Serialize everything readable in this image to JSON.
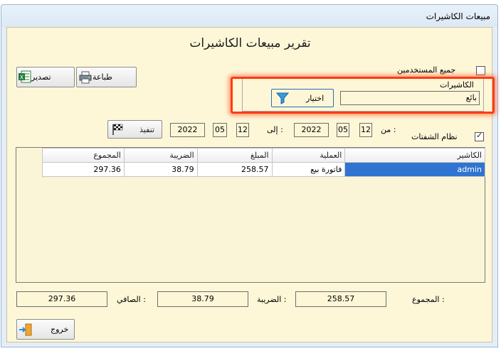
{
  "window": {
    "title": "مبيعات الكاشيرات"
  },
  "report": {
    "title": "تقرير مبيعات الكاشيرات"
  },
  "toolbar": {
    "print_label": "طباعة",
    "export_label": "تصدير",
    "execute_label": "تنفيذ",
    "exit_label": "خروج"
  },
  "filters": {
    "all_users_label": "جميع المستخدمين",
    "all_users_checked": false,
    "cashiers_group_label": "الكاشيرات",
    "cashier_value": "بائع",
    "choose_label": "اختيار",
    "shifts_label": "نظام الشفتات",
    "shifts_checked": true,
    "from_label": "من :",
    "to_label": "إلى :",
    "from": {
      "day": "12",
      "month": "05",
      "year": "2022"
    },
    "to": {
      "day": "12",
      "month": "05",
      "year": "2022"
    }
  },
  "table": {
    "columns": [
      "الكاشير",
      "العملية",
      "المبلغ",
      "الضريبة",
      "المجموع"
    ],
    "rows": [
      {
        "cashier": "admin",
        "operation": "فاتورة بيع",
        "amount": "258.57",
        "tax": "38.79",
        "total": "297.36"
      }
    ]
  },
  "summary": {
    "total_label": "المجموع :",
    "total_value": "258.57",
    "tax_label": "الضريبة :",
    "tax_value": "38.79",
    "net_label": "الصافي :",
    "net_value": "297.36"
  },
  "colors": {
    "background": "#fdf7d8",
    "selection": "#2f74d0",
    "highlight": "#ff3b12"
  },
  "icons": {
    "print": "printer-icon",
    "export": "excel-icon",
    "filter": "filter-icon",
    "execute": "checkered-flag-icon",
    "exit": "exit-door-icon"
  }
}
